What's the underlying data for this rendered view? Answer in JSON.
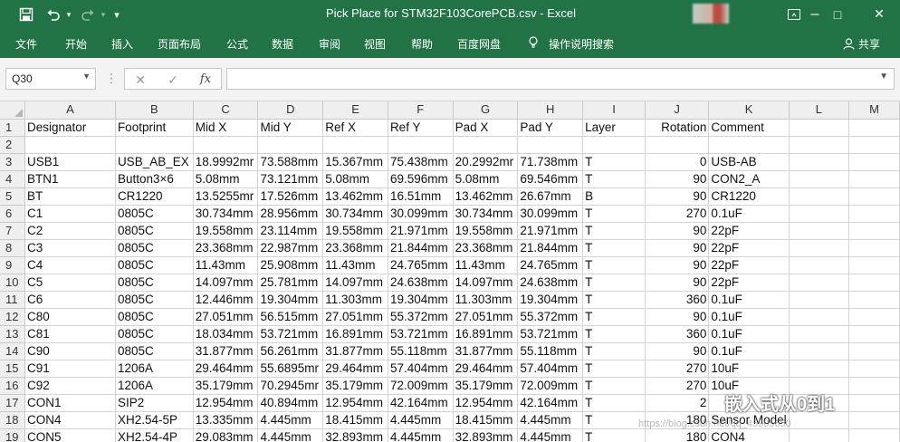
{
  "window": {
    "title": "Pick Place for STM32F103CorePCB.csv  -  Excel",
    "qa_customize": "▾",
    "minimize": "–",
    "maximize": "□",
    "close": "✕"
  },
  "ribbon": {
    "tabs": [
      "文件",
      "开始",
      "插入",
      "页面布局",
      "公式",
      "数据",
      "审阅",
      "视图",
      "帮助",
      "百度网盘",
      "操作说明搜索"
    ],
    "share": "共享"
  },
  "formula_bar": {
    "name_box": "Q30",
    "cancel": "✕",
    "enter": "✓",
    "fx": "fx",
    "content": ""
  },
  "columns": [
    "A",
    "B",
    "C",
    "D",
    "E",
    "F",
    "G",
    "H",
    "I",
    "J",
    "K",
    "L",
    "M"
  ],
  "rows": [
    {
      "n": "1",
      "cells": [
        "Designator",
        "Footprint",
        "Mid X",
        "Mid Y",
        "Ref X",
        "Ref Y",
        "Pad X",
        "Pad Y",
        "Layer",
        "Rotation",
        "Comment",
        "",
        ""
      ]
    },
    {
      "n": "2",
      "cells": [
        "",
        "",
        "",
        "",
        "",
        "",
        "",
        "",
        "",
        "",
        "",
        "",
        ""
      ]
    },
    {
      "n": "3",
      "cells": [
        "USB1",
        "USB_AB_EX",
        "18.9992mr",
        "73.588mm",
        "15.367mm",
        "75.438mm",
        "20.2992mr",
        "71.738mm",
        "T",
        "0",
        "USB-AB",
        "",
        ""
      ]
    },
    {
      "n": "4",
      "cells": [
        "BTN1",
        "Button3×6",
        "5.08mm",
        "73.121mm",
        "5.08mm",
        "69.596mm",
        "5.08mm",
        "69.546mm",
        "T",
        "90",
        "CON2_A",
        "",
        ""
      ]
    },
    {
      "n": "5",
      "cells": [
        "BT",
        "CR1220",
        "13.5255mr",
        "17.526mm",
        "13.462mm",
        "16.51mm",
        "13.462mm",
        "26.67mm",
        "B",
        "90",
        "CR1220",
        "",
        ""
      ]
    },
    {
      "n": "6",
      "cells": [
        "C1",
        "0805C",
        "30.734mm",
        "28.956mm",
        "30.734mm",
        "30.099mm",
        "30.734mm",
        "30.099mm",
        "T",
        "270",
        "0.1uF",
        "",
        ""
      ]
    },
    {
      "n": "7",
      "cells": [
        "C2",
        "0805C",
        "19.558mm",
        "23.114mm",
        "19.558mm",
        "21.971mm",
        "19.558mm",
        "21.971mm",
        "T",
        "90",
        "22pF",
        "",
        ""
      ]
    },
    {
      "n": "8",
      "cells": [
        "C3",
        "0805C",
        "23.368mm",
        "22.987mm",
        "23.368mm",
        "21.844mm",
        "23.368mm",
        "21.844mm",
        "T",
        "90",
        "22pF",
        "",
        ""
      ]
    },
    {
      "n": "9",
      "cells": [
        "C4",
        "0805C",
        "11.43mm",
        "25.908mm",
        "11.43mm",
        "24.765mm",
        "11.43mm",
        "24.765mm",
        "T",
        "90",
        "22pF",
        "",
        ""
      ]
    },
    {
      "n": "10",
      "cells": [
        "C5",
        "0805C",
        "14.097mm",
        "25.781mm",
        "14.097mm",
        "24.638mm",
        "14.097mm",
        "24.638mm",
        "T",
        "90",
        "22pF",
        "",
        ""
      ]
    },
    {
      "n": "11",
      "cells": [
        "C6",
        "0805C",
        "12.446mm",
        "19.304mm",
        "11.303mm",
        "19.304mm",
        "11.303mm",
        "19.304mm",
        "T",
        "360",
        "0.1uF",
        "",
        ""
      ]
    },
    {
      "n": "12",
      "cells": [
        "C80",
        "0805C",
        "27.051mm",
        "56.515mm",
        "27.051mm",
        "55.372mm",
        "27.051mm",
        "55.372mm",
        "T",
        "90",
        "0.1uF",
        "",
        ""
      ]
    },
    {
      "n": "13",
      "cells": [
        "C81",
        "0805C",
        "18.034mm",
        "53.721mm",
        "16.891mm",
        "53.721mm",
        "16.891mm",
        "53.721mm",
        "T",
        "360",
        "0.1uF",
        "",
        ""
      ]
    },
    {
      "n": "14",
      "cells": [
        "C90",
        "0805C",
        "31.877mm",
        "56.261mm",
        "31.877mm",
        "55.118mm",
        "31.877mm",
        "55.118mm",
        "T",
        "90",
        "0.1uF",
        "",
        ""
      ]
    },
    {
      "n": "15",
      "cells": [
        "C91",
        "1206A",
        "29.464mm",
        "55.6895mr",
        "29.464mm",
        "57.404mm",
        "29.464mm",
        "57.404mm",
        "T",
        "270",
        "10uF",
        "",
        ""
      ]
    },
    {
      "n": "16",
      "cells": [
        "C92",
        "1206A",
        "35.179mm",
        "70.2945mr",
        "35.179mm",
        "72.009mm",
        "35.179mm",
        "72.009mm",
        "T",
        "270",
        "10uF",
        "",
        ""
      ]
    },
    {
      "n": "17",
      "cells": [
        "CON1",
        "SIP2",
        "12.954mm",
        "40.894mm",
        "12.954mm",
        "42.164mm",
        "12.954mm",
        "42.164mm",
        "T",
        "2",
        "",
        "",
        ""
      ]
    },
    {
      "n": "18",
      "cells": [
        "CON4",
        "XH2.54-5P",
        "13.335mm",
        "4.445mm",
        "18.415mm",
        "4.445mm",
        "18.415mm",
        "4.445mm",
        "T",
        "180",
        "Sensor Model",
        "",
        ""
      ]
    },
    {
      "n": "19",
      "cells": [
        "CON5",
        "XH2.54-4P",
        "29.083mm",
        "4.445mm",
        "32.893mm",
        "4.445mm",
        "32.893mm",
        "4.445mm",
        "T",
        "180",
        "CON4",
        "",
        ""
      ]
    }
  ],
  "watermark": {
    "text": "嵌入式从0到1",
    "url": "https://blog.csdn.net/qq_45905650"
  }
}
